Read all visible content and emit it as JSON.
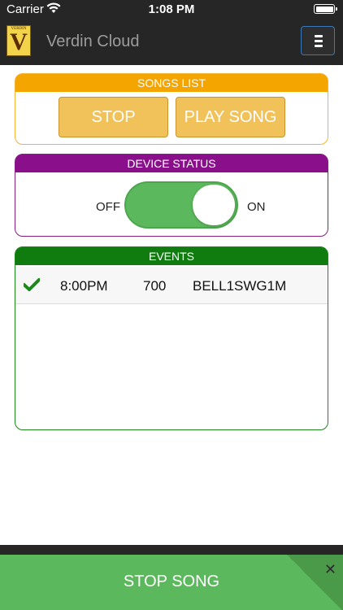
{
  "status_bar": {
    "carrier": "Carrier",
    "time": "1:08 PM",
    "wifi_icon": "wifi-icon",
    "battery_icon": "battery-icon"
  },
  "app": {
    "logo_text": "VERDIN",
    "logo_letter": "V",
    "title": "Verdin Cloud",
    "menu_icon": "hamburger-icon"
  },
  "songs_list": {
    "title": "SONGS LIST",
    "stop_label": "STOP",
    "play_label": "PLAY SONG"
  },
  "device_status": {
    "title": "DEVICE STATUS",
    "off_label": "OFF",
    "on_label": "ON",
    "toggle_state": "on"
  },
  "events": {
    "title": "EVENTS",
    "rows": [
      {
        "checked": true,
        "time": "8:00PM",
        "number": "700",
        "name": "BELL1SWG1M"
      }
    ]
  },
  "bottom": {
    "stop_song_label": "STOP SONG",
    "close_icon": "close-icon"
  },
  "colors": {
    "songs_header": "#f5a500",
    "device_header": "#8a0f8a",
    "events_header": "#107c10",
    "toggle_on": "#5cb85c",
    "button_gold": "#f1c15a",
    "stop_song_bg": "#5cb85c"
  }
}
